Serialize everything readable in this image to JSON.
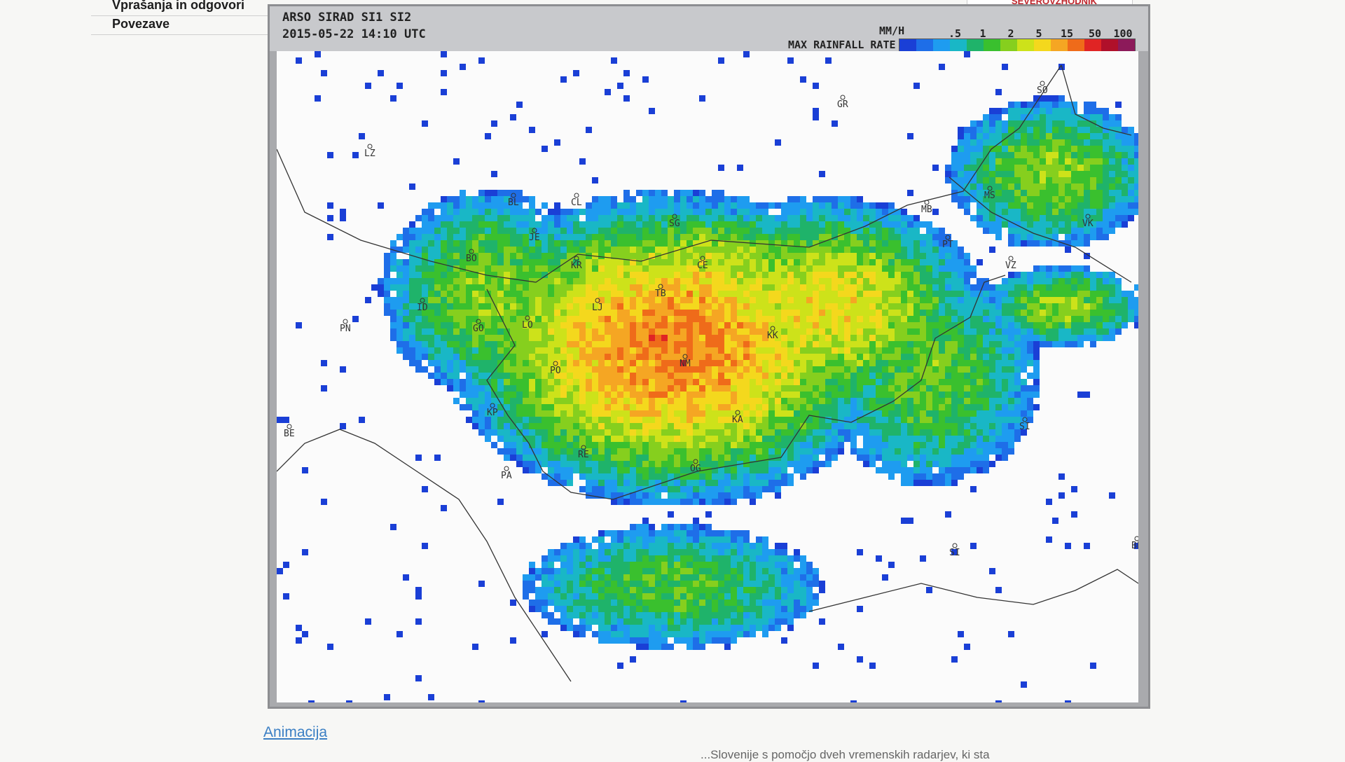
{
  "sidebar": {
    "items": [
      {
        "label": "Vprašanja in odgovori"
      },
      {
        "label": "Povezave"
      }
    ]
  },
  "top_strip": {
    "text": "SEVEROVZHODNIK"
  },
  "radar": {
    "header_line1": "ARSO SIRAD SI1 SI2",
    "header_line2": "2015-05-22 14:10 UTC",
    "unit": "MM/H",
    "legend_title": "MAX RAINFALL RATE",
    "legend_ticks": [
      ".5",
      "1",
      "2",
      "5",
      "15",
      "50",
      "100"
    ],
    "legend_colors": [
      "#1a3fd6",
      "#1e6ee8",
      "#1e9cf0",
      "#19b7c6",
      "#1fb36a",
      "#3ac02e",
      "#86cf1e",
      "#cde21a",
      "#f4d81d",
      "#f5a623",
      "#ef6b1a",
      "#e02424",
      "#b0102a",
      "#8c1a5a"
    ],
    "stations": [
      {
        "code": "SO"
      },
      {
        "code": "GR"
      },
      {
        "code": "LZ"
      },
      {
        "code": "BL"
      },
      {
        "code": "CL"
      },
      {
        "code": "MB"
      },
      {
        "code": "MS"
      },
      {
        "code": "VK"
      },
      {
        "code": "SG"
      },
      {
        "code": "JE"
      },
      {
        "code": "PT"
      },
      {
        "code": "BO"
      },
      {
        "code": "KR"
      },
      {
        "code": "CE"
      },
      {
        "code": "VZ"
      },
      {
        "code": "TB"
      },
      {
        "code": "LJ"
      },
      {
        "code": "ID"
      },
      {
        "code": "LO"
      },
      {
        "code": "KK"
      },
      {
        "code": "NM"
      },
      {
        "code": "PO"
      },
      {
        "code": "GO"
      },
      {
        "code": "KP"
      },
      {
        "code": "KA"
      },
      {
        "code": "SI"
      },
      {
        "code": "PA"
      },
      {
        "code": "RE"
      },
      {
        "code": "OG"
      },
      {
        "code": "BE"
      },
      {
        "code": "SI"
      },
      {
        "code": "BL"
      },
      {
        "code": "PN"
      }
    ]
  },
  "links": {
    "animation": "Animacija"
  },
  "footer": {
    "text": "...Slovenije s pomočjo dveh vremenskih radarjev, ki sta"
  }
}
